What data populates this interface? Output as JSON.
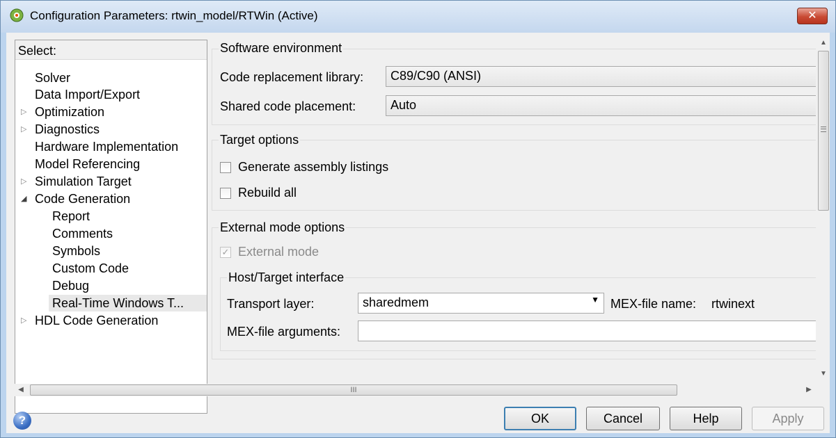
{
  "window": {
    "title": "Configuration Parameters: rtwin_model/RTWin (Active)",
    "close_glyph": "✕"
  },
  "tree": {
    "header": "Select:",
    "items": [
      {
        "label": "Solver",
        "expander": ""
      },
      {
        "label": "Data Import/Export",
        "expander": ""
      },
      {
        "label": "Optimization",
        "expander": "▷"
      },
      {
        "label": "Diagnostics",
        "expander": "▷"
      },
      {
        "label": "Hardware Implementation",
        "expander": ""
      },
      {
        "label": "Model Referencing",
        "expander": ""
      },
      {
        "label": "Simulation Target",
        "expander": "▷"
      },
      {
        "label": "Code Generation",
        "expander": "◢"
      },
      {
        "label": "Report",
        "expander": ""
      },
      {
        "label": "Comments",
        "expander": ""
      },
      {
        "label": "Symbols",
        "expander": ""
      },
      {
        "label": "Custom Code",
        "expander": ""
      },
      {
        "label": "Debug",
        "expander": ""
      },
      {
        "label": "Real-Time Windows T...",
        "expander": ""
      },
      {
        "label": "HDL Code Generation",
        "expander": "▷"
      }
    ]
  },
  "software_environment": {
    "title": "Software environment",
    "code_replacement_label": "Code replacement library:",
    "code_replacement_value": "C89/C90 (ANSI)",
    "shared_code_label": "Shared code placement:",
    "shared_code_value": "Auto"
  },
  "target_options": {
    "title": "Target options",
    "generate_assembly_label": "Generate assembly listings",
    "rebuild_all_label": "Rebuild all"
  },
  "external_mode_options": {
    "title": "External mode options",
    "external_mode_label": "External mode",
    "check_glyph": "✓",
    "host_target": {
      "title": "Host/Target interface",
      "transport_label": "Transport layer:",
      "transport_value": "sharedmem",
      "dropdown_glyph": "▼",
      "mex_name_label": "MEX-file name:",
      "mex_name_value": "rtwinext",
      "mex_args_label": "MEX-file arguments:",
      "mex_args_value": ""
    }
  },
  "scrollbars": {
    "up": "▲",
    "down": "▼",
    "left": "◀",
    "right": "▶",
    "hthumb_grip": "III"
  },
  "buttons": {
    "help_icon": "?",
    "ok": "OK",
    "cancel": "Cancel",
    "help": "Help",
    "apply": "Apply"
  }
}
